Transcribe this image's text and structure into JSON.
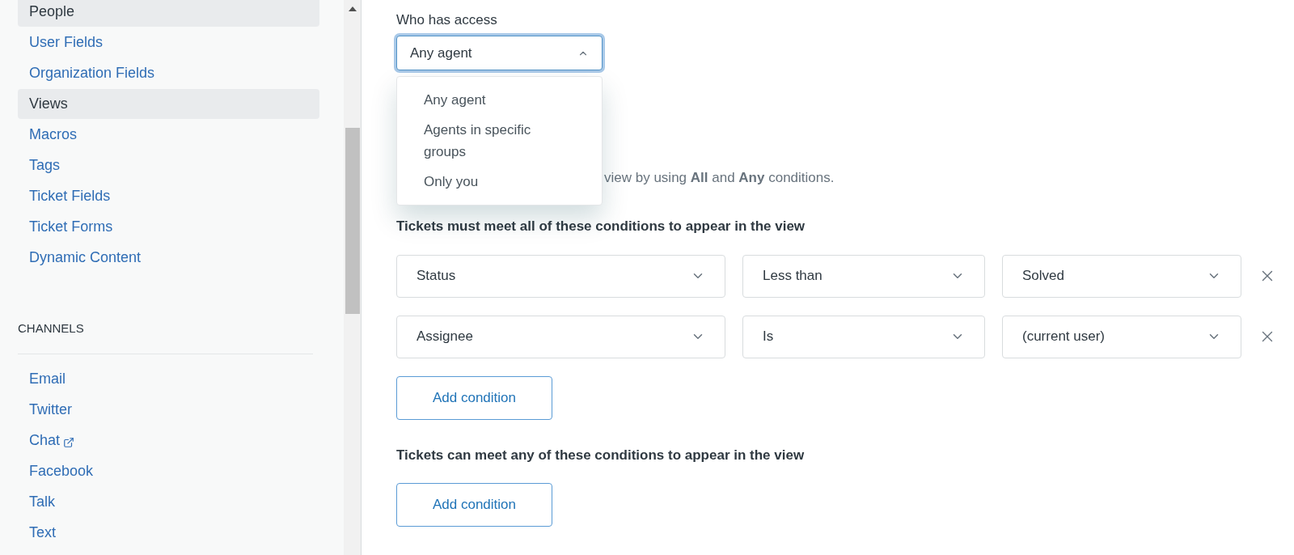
{
  "sidebar": {
    "items": [
      {
        "label": "People",
        "selected": true,
        "external": false
      },
      {
        "label": "User Fields",
        "selected": false,
        "external": false
      },
      {
        "label": "Organization Fields",
        "selected": false,
        "external": false
      },
      {
        "label": "Views",
        "selected": true,
        "external": false
      },
      {
        "label": "Macros",
        "selected": false,
        "external": false
      },
      {
        "label": "Tags",
        "selected": false,
        "external": false
      },
      {
        "label": "Ticket Fields",
        "selected": false,
        "external": false
      },
      {
        "label": "Ticket Forms",
        "selected": false,
        "external": false
      },
      {
        "label": "Dynamic Content",
        "selected": false,
        "external": false
      }
    ],
    "sections": [
      {
        "title": "CHANNELS",
        "items": [
          {
            "label": "Email",
            "selected": false,
            "external": false
          },
          {
            "label": "Twitter",
            "selected": false,
            "external": false
          },
          {
            "label": "Chat",
            "selected": false,
            "external": true
          },
          {
            "label": "Facebook",
            "selected": false,
            "external": false
          },
          {
            "label": "Talk",
            "selected": false,
            "external": false
          },
          {
            "label": "Text",
            "selected": false,
            "external": false
          }
        ]
      }
    ]
  },
  "access": {
    "label": "Who has access",
    "value": "Any agent",
    "expanded": true,
    "options": [
      "Any agent",
      "Agents in specific groups",
      "Only you"
    ]
  },
  "description": "view by using **All** and **Any** conditions.",
  "all_conditions": {
    "heading": "Tickets must meet all of these conditions to appear in the view",
    "rows": [
      {
        "field": "Status",
        "operator": "Less than",
        "value": "Solved"
      },
      {
        "field": "Assignee",
        "operator": "Is",
        "value": "(current user)"
      }
    ],
    "button": "Add condition"
  },
  "any_conditions": {
    "heading": "Tickets can meet any of these conditions to appear in the view",
    "button": "Add condition"
  }
}
